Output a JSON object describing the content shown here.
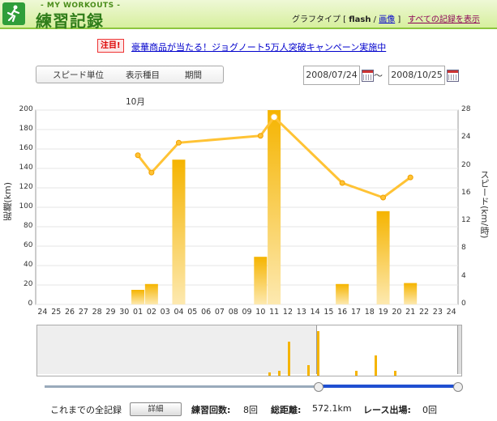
{
  "header": {
    "brand_sub": "- MY WORKOUTS -",
    "brand_main": "練習記録",
    "graph_type_prefix": "グラフタイプ [ ",
    "graph_type_flash": "flash",
    "graph_type_sep": " / ",
    "graph_type_image": "画像",
    "graph_type_suffix": " ]",
    "all_records_link": "すべての記録を表示"
  },
  "notice": {
    "badge": "注目!",
    "text": "豪華商品が当たる！ジョグノート5万人突破キャンペーン実施中"
  },
  "toolbar": {
    "speed_unit": "スピード単位",
    "display_item": "表示種目",
    "period": "期間",
    "date_from": "2008/07/24",
    "date_to": "2008/10/25",
    "tilde": "〜"
  },
  "colors": {
    "bar": "#f5b400",
    "line": "#ffc335",
    "accent_green": "#8dc63f",
    "slider_blue": "#1f4fd1"
  },
  "chart_data": {
    "type": "bar",
    "month_label": "10月",
    "xlabel": "",
    "ylabel": "距離(km)",
    "ylabel_right": "スピード(km/時)",
    "ylim": [
      0,
      200
    ],
    "ylim_right": [
      0,
      28
    ],
    "yticks": [
      0,
      20,
      40,
      60,
      80,
      100,
      120,
      140,
      160,
      180,
      200
    ],
    "yticks_right": [
      0,
      4,
      8,
      12,
      16,
      20,
      24,
      28
    ],
    "categories": [
      "24",
      "25",
      "26",
      "27",
      "28",
      "29",
      "30",
      "01",
      "02",
      "03",
      "04",
      "05",
      "06",
      "07",
      "08",
      "09",
      "10",
      "11",
      "12",
      "13",
      "14",
      "15",
      "16",
      "17",
      "18",
      "19",
      "20",
      "21",
      "22",
      "23",
      "24"
    ],
    "series": [
      {
        "kind": "bar",
        "axis": "left",
        "values": [
          0,
          0,
          0,
          0,
          0,
          0,
          0,
          15,
          21,
          0,
          149,
          0,
          0,
          0,
          0,
          0,
          49,
          200,
          0,
          0,
          0,
          0,
          21,
          0,
          0,
          96,
          0,
          22,
          0,
          0,
          0
        ]
      },
      {
        "kind": "line",
        "axis": "right",
        "points": [
          [
            7,
            21.5
          ],
          [
            8,
            19
          ],
          [
            10,
            23.3
          ],
          [
            16,
            24.3
          ],
          [
            17,
            27
          ],
          [
            22,
            17.5
          ],
          [
            25,
            15.4
          ],
          [
            27,
            18.3
          ]
        ]
      }
    ],
    "grid": true
  },
  "overview": {
    "bars": [
      [
        24,
        3
      ],
      [
        25,
        4
      ],
      [
        26,
        28
      ],
      [
        28,
        9
      ],
      [
        29,
        37
      ],
      [
        33,
        4
      ],
      [
        35,
        17
      ],
      [
        37,
        4
      ]
    ]
  },
  "footer": {
    "all_records_label": "これまでの全記録",
    "detail_button": "詳細",
    "practice_count_label": "練習回数:",
    "practice_count": "8回",
    "total_distance_label": "総距離:",
    "total_distance": "572.1km",
    "race_label": "レース出場:",
    "race_count": "0回"
  }
}
